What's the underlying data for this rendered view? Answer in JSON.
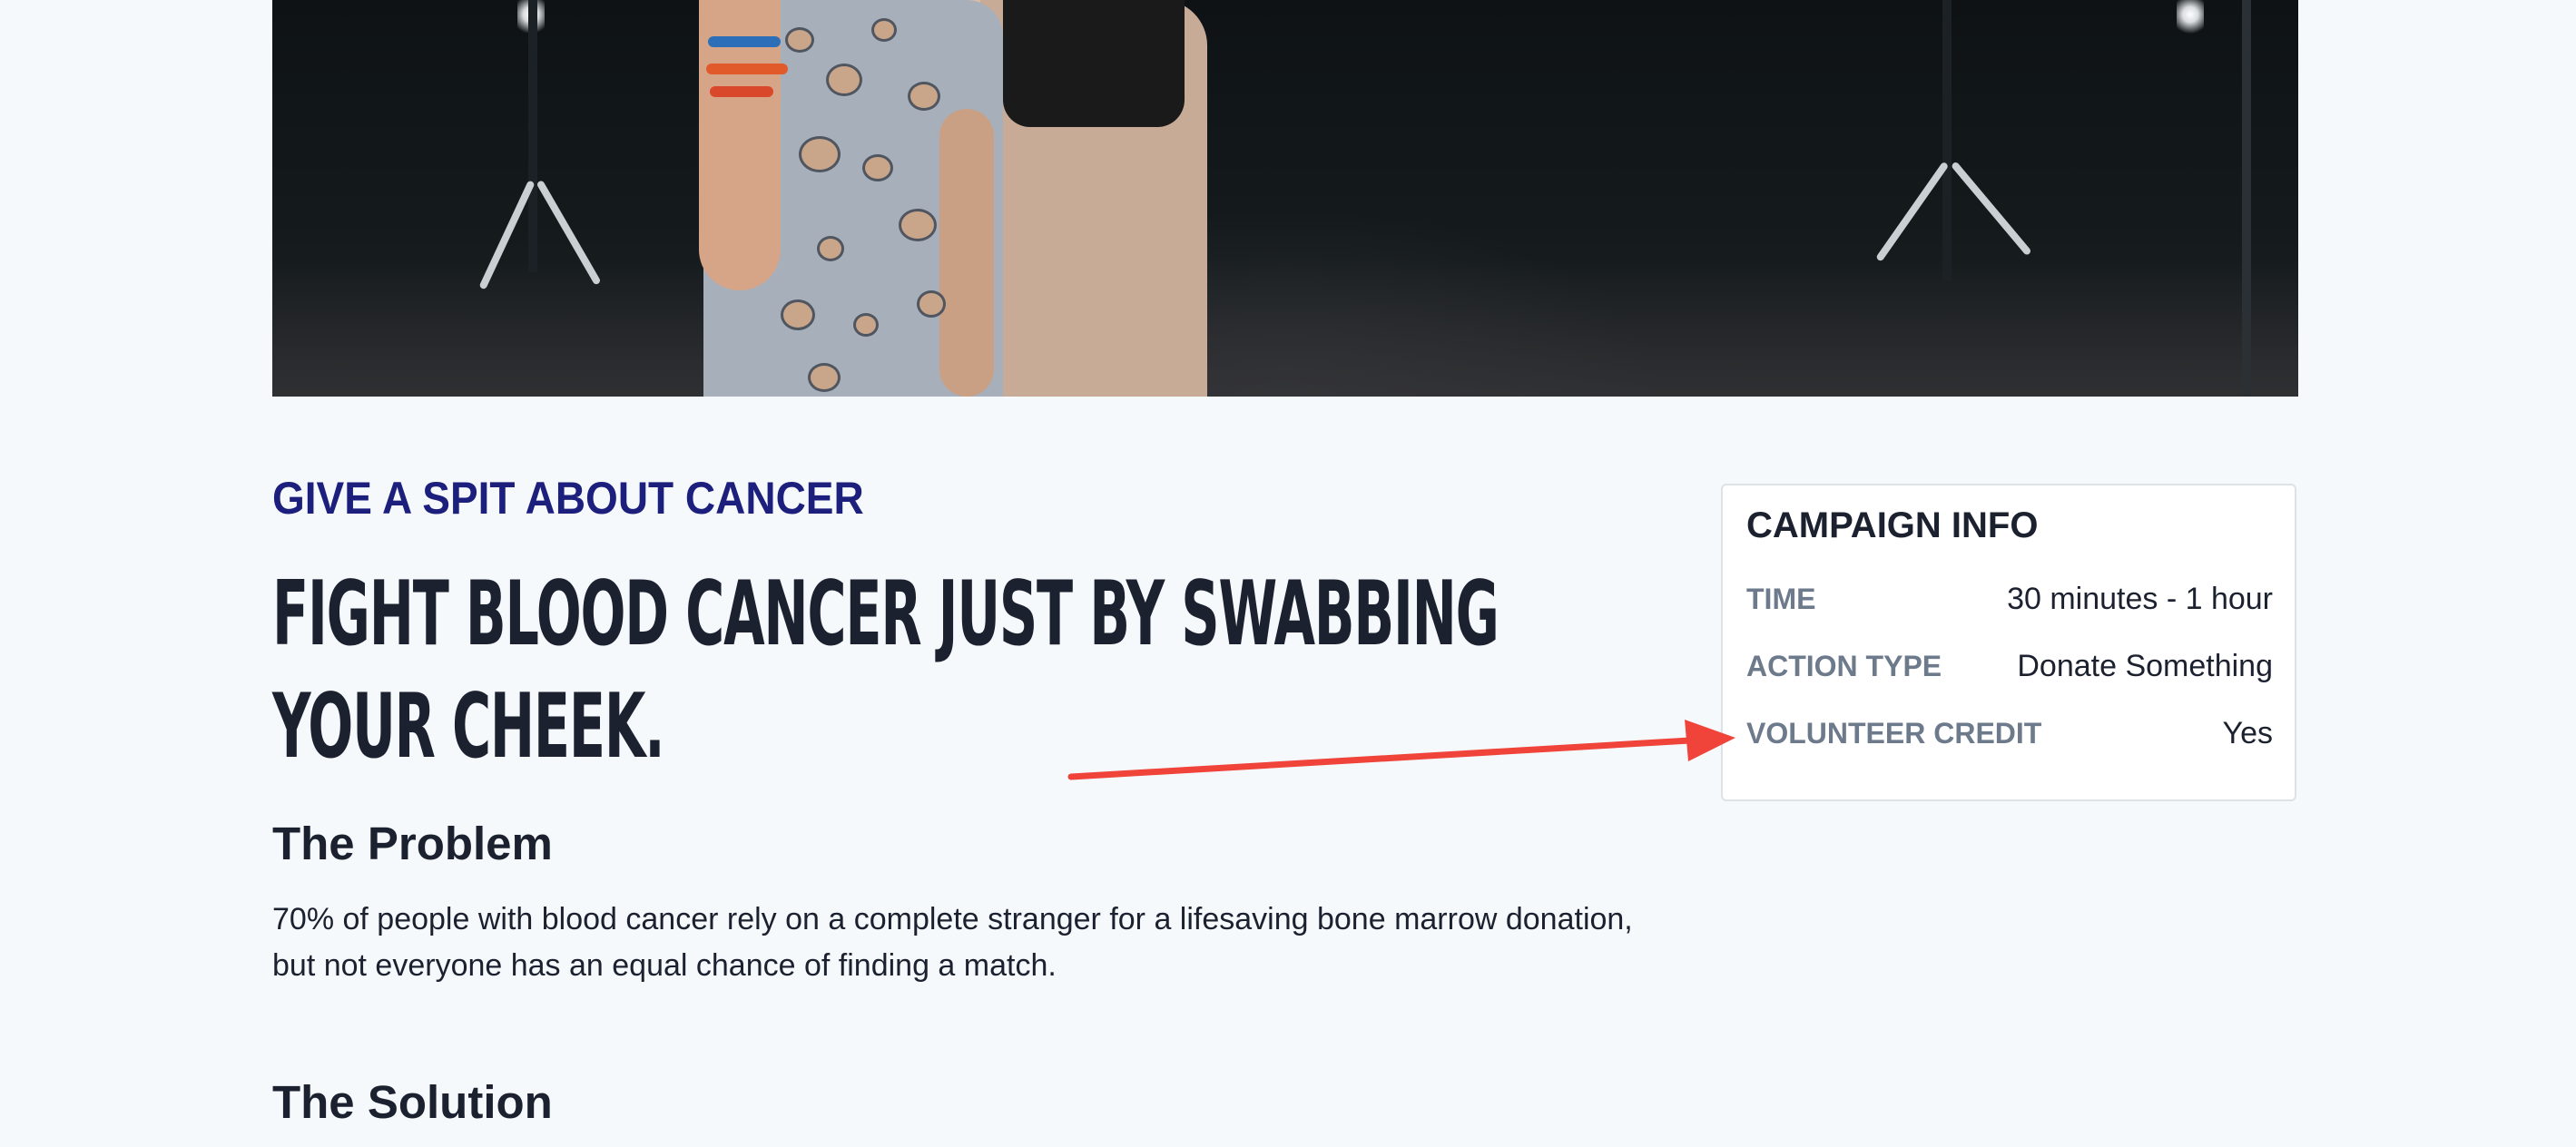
{
  "campaign": {
    "eyebrow": "GIVE A SPIT ABOUT CANCER",
    "headline": "FIGHT BLOOD CANCER JUST BY SWABBING YOUR CHEEK.",
    "sections": [
      {
        "title": "The Problem",
        "body": "70% of people with blood cancer rely on a complete stranger for a lifesaving bone marrow donation, but not everyone has an equal chance of finding a match."
      },
      {
        "title": "The Solution",
        "body": ""
      }
    ]
  },
  "campaign_info": {
    "title": "CAMPAIGN INFO",
    "rows": [
      {
        "label": "TIME",
        "value": "30 minutes - 1 hour"
      },
      {
        "label": "ACTION TYPE",
        "value": "Donate Something"
      },
      {
        "label": "VOLUNTEER CREDIT",
        "value": "Yes"
      }
    ]
  },
  "colors": {
    "page_background": "#f5f9fc",
    "eyebrow": "#1d1f7d",
    "text": "#1c2130",
    "muted_label": "#6c7a8c",
    "card_border": "#dde2e7",
    "annotation_arrow": "#f0433a"
  },
  "annotation": {
    "icon": "red-arrow-icon",
    "target": "volunteer-credit-row"
  }
}
